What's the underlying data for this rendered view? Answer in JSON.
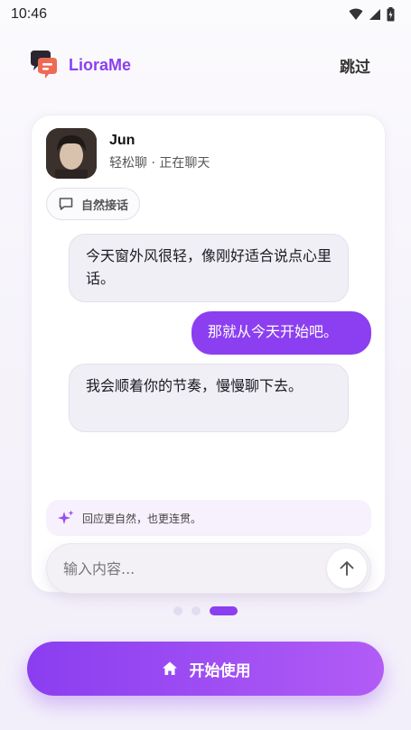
{
  "status_bar": {
    "time": "10:46"
  },
  "header": {
    "app_name": "LioraMe",
    "skip_label": "跳过"
  },
  "profile": {
    "name": "Jun",
    "status": "轻松聊 · 正在聊天"
  },
  "chip": {
    "label": "自然接话",
    "icon": "chat-bubble-icon"
  },
  "messages": [
    {
      "role": "assistant",
      "text": "今天窗外风很轻，像刚好适合说点心里话。"
    },
    {
      "role": "user",
      "text": "那就从今天开始吧。"
    },
    {
      "role": "assistant",
      "text": "我会顺着你的节奏，慢慢聊下去。"
    }
  ],
  "hint": {
    "text": "回应更自然，也更连贯。",
    "icon": "sparkle-icon"
  },
  "composer": {
    "placeholder": "输入内容...",
    "value": ""
  },
  "pager": {
    "total": 3,
    "current": 3
  },
  "cta": {
    "label": "开始使用",
    "icon": "home-icon"
  },
  "colors": {
    "accent": "#8b3ff0",
    "accent_light": "#b25cf6",
    "bubble_in": "#f0eff5"
  }
}
